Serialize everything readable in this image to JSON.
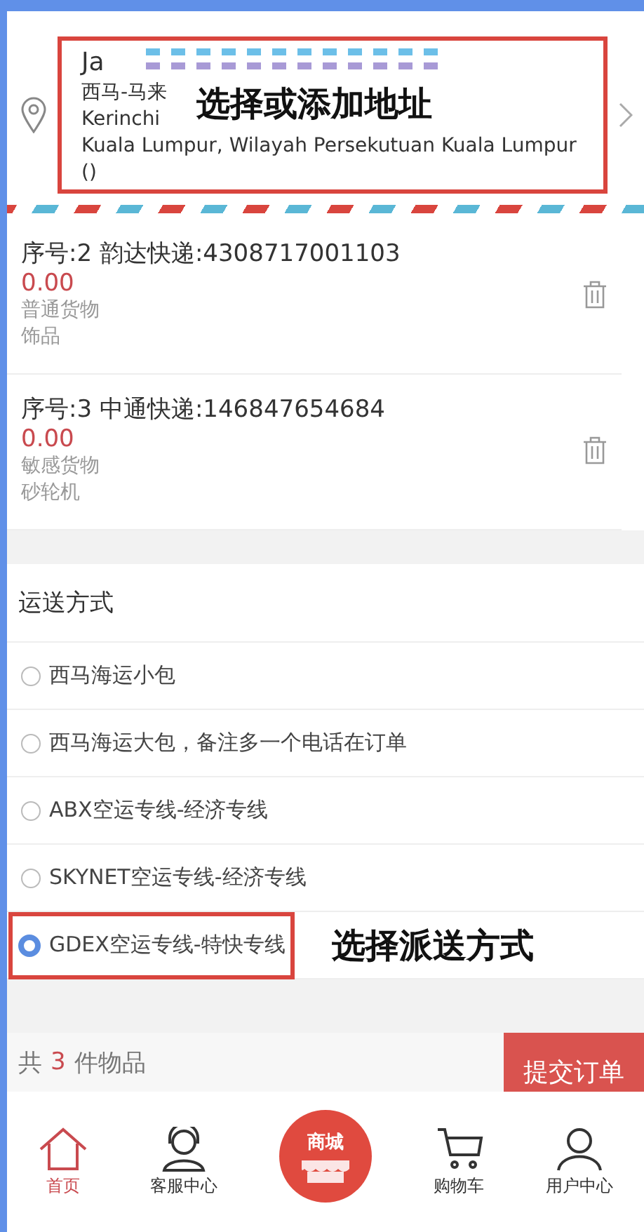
{
  "address": {
    "name": "Ja",
    "lines": [
      "西马-马来",
      "Kerinchi",
      "Kuala Lumpur, Wilayah Persekutuan Kuala Lumpur ()"
    ],
    "annotation": "选择或添加地址"
  },
  "parcels": [
    {
      "title": "序号:2 韵达快递:4308717001103",
      "price": "0.00",
      "category": "普通货物",
      "item": "饰品"
    },
    {
      "title": "序号:3 中通快递:146847654684",
      "price": "0.00",
      "category": "敏感货物",
      "item": "砂轮机"
    }
  ],
  "shipping": {
    "heading": "运送方式",
    "annotation": "选择派送方式",
    "options": [
      {
        "label": "西马海运小包",
        "selected": false
      },
      {
        "label": "西马海运大包，备注多一个电话在订单",
        "selected": false
      },
      {
        "label": "ABX空运专线-经济专线",
        "selected": false
      },
      {
        "label": "SKYNET空运专线-经济专线",
        "selected": false
      },
      {
        "label": "GDEX空运专线-特快专线",
        "selected": true
      }
    ]
  },
  "summary": {
    "prefix": "共",
    "count": "3",
    "suffix": "件物品",
    "submit": "提交订单"
  },
  "tabs": [
    {
      "kind": "home",
      "label": "首页",
      "selected": true
    },
    {
      "kind": "service",
      "label": "客服中心",
      "selected": false
    },
    {
      "kind": "mall",
      "label": "商城",
      "selected": false
    },
    {
      "kind": "cart",
      "label": "购物车",
      "selected": false
    },
    {
      "kind": "user",
      "label": "用户中心",
      "selected": false
    }
  ]
}
